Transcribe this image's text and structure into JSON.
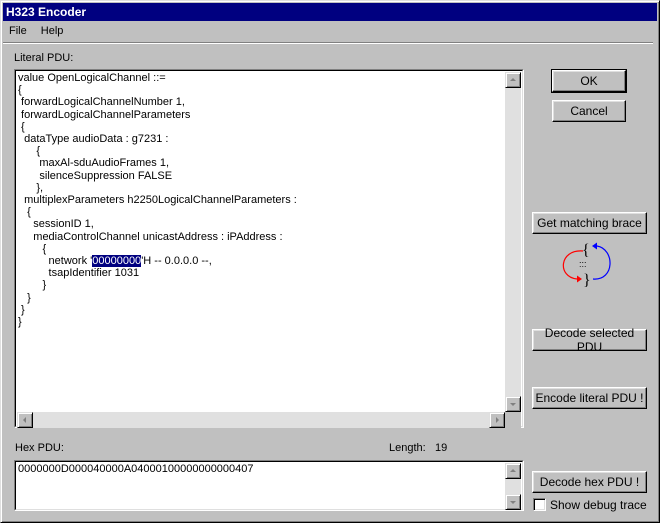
{
  "window": {
    "title": "H323 Encoder"
  },
  "menu": [
    {
      "label": "File"
    },
    {
      "label": "Help"
    }
  ],
  "literal_pdu": {
    "label": "Literal PDU:",
    "lines_before_selection": "value OpenLogicalChannel ::=\n{\n forwardLogicalChannelNumber 1,\n forwardLogicalChannelParameters\n {\n  dataType audioData : g7231 :\n      {\n       maxAl-sduAudioFrames 1,\n       silenceSuppression FALSE\n      },\n  multiplexParameters h2250LogicalChannelParameters :\n   {\n     sessionID 1,\n     mediaControlChannel unicastAddress : iPAddress :\n        {\n          network '",
    "selected_text": "00000000",
    "lines_after_selection": "'H -- 0.0.0.0 --,\n          tsapIdentifier 1031\n        }\n   }\n }\n}"
  },
  "hex_pdu": {
    "label": "Hex PDU:",
    "length_label": "Length:",
    "length_value": "19",
    "value": "0000000D000040000A04000100000000000407"
  },
  "buttons": {
    "ok": "OK",
    "cancel": "Cancel",
    "get_matching_brace": "Get matching brace",
    "decode_selected": "Decode selected PDU",
    "encode_literal": "Encode literal PDU !",
    "decode_hex": "Decode hex PDU !"
  },
  "brace_icon": {
    "open_glyph": "{",
    "close_glyph": "}",
    "ellipsis": ":::",
    "left_arrow_color": "#ff0000",
    "right_arrow_color": "#0000ff"
  },
  "debug_trace": {
    "label": "Show debug trace",
    "checked": false
  }
}
